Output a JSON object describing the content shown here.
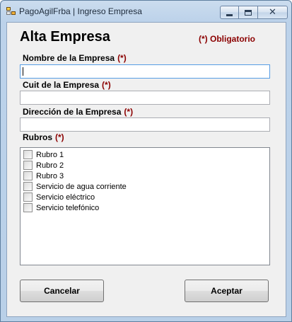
{
  "window": {
    "title": "PagoAgilFrba | Ingreso Empresa",
    "close_glyph": "✕"
  },
  "form": {
    "title": "Alta Empresa",
    "required_legend": "(*) Obligatorio",
    "required_mark": "(*)",
    "fields": [
      {
        "label": "Nombre de la Empresa",
        "value": ""
      },
      {
        "label": "Cuit de la Empresa",
        "value": ""
      },
      {
        "label": "Dirección de la Empresa",
        "value": ""
      }
    ],
    "rubros": {
      "label": "Rubros",
      "items": [
        {
          "label": "Rubro 1",
          "checked": false
        },
        {
          "label": "Rubro 2",
          "checked": false
        },
        {
          "label": "Rubro 3",
          "checked": false
        },
        {
          "label": "Servicio de agua corriente",
          "checked": false
        },
        {
          "label": "Servicio eléctrico",
          "checked": false
        },
        {
          "label": "Servicio telefónico",
          "checked": false
        }
      ]
    }
  },
  "buttons": {
    "cancel": "Cancelar",
    "accept": "Aceptar"
  }
}
